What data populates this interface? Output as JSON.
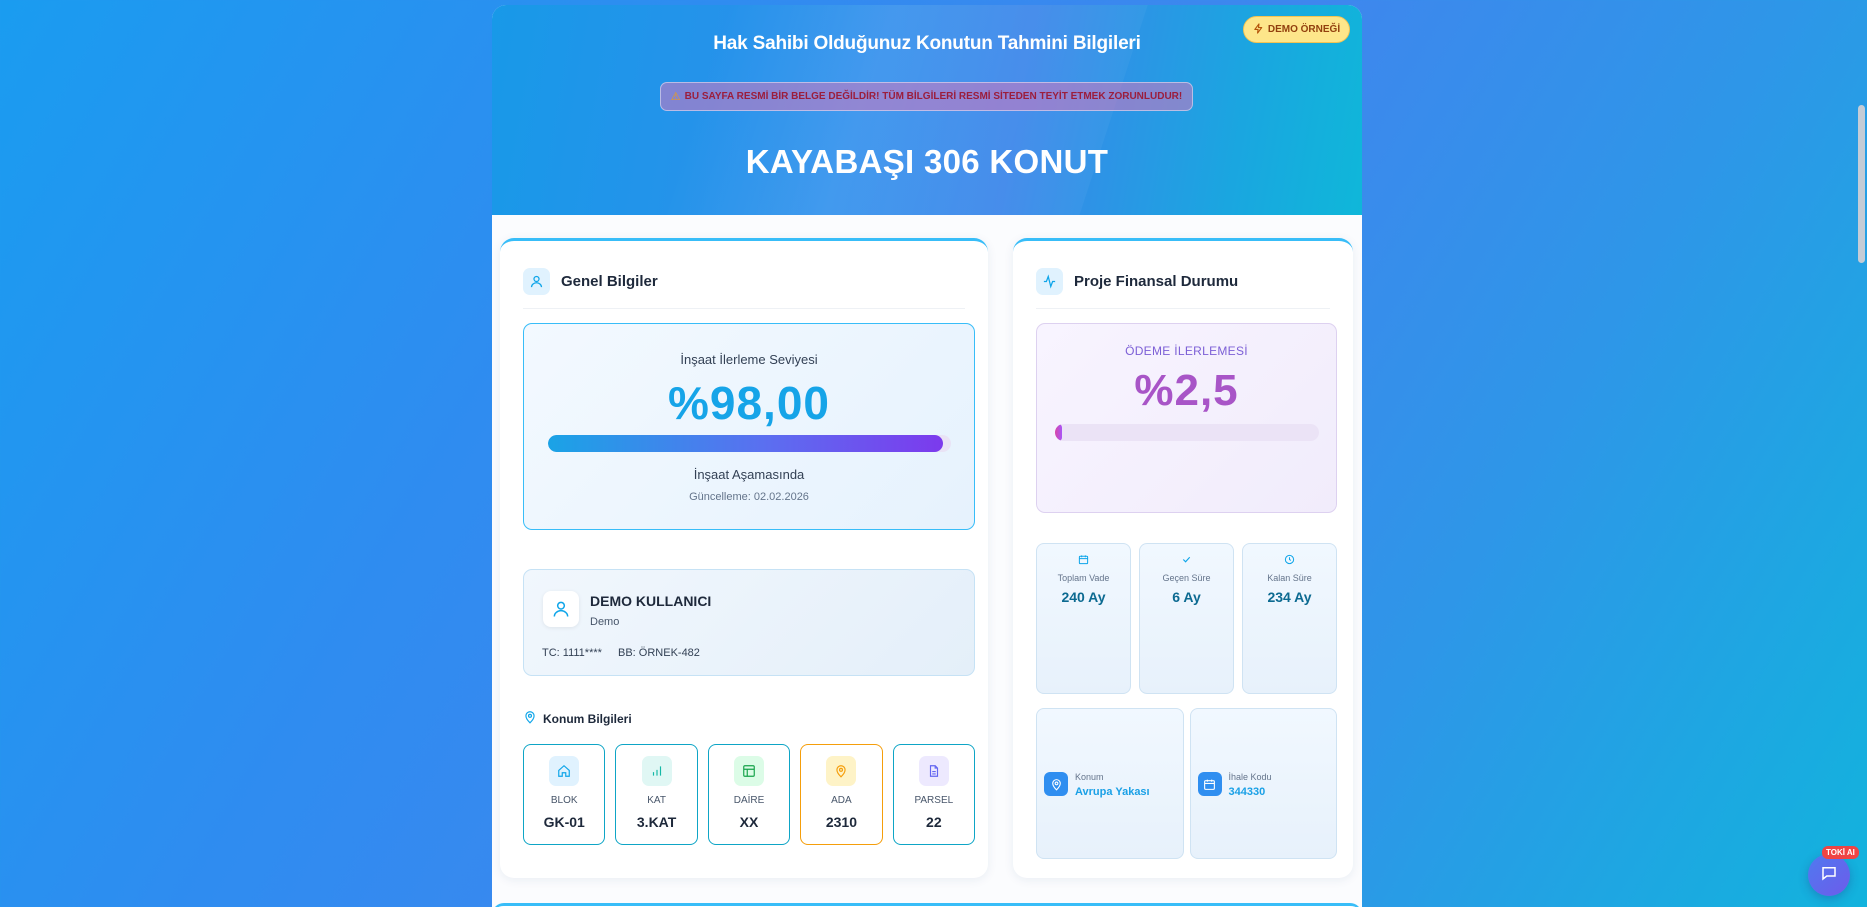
{
  "hero": {
    "title": "Hak Sahibi Olduğunuz Konutun Tahmini Bilgileri",
    "warning": "BU SAYFA RESMİ BİR BELGE DEĞİLDİR! TÜM BİLGİLERİ RESMİ SİTEDEN TEYİT ETMEK ZORUNLUDUR!",
    "project_name": "KAYABAŞI 306 KONUT",
    "demo_badge": "DEMO ÖRNEĞİ"
  },
  "general": {
    "title": "Genel Bilgiler",
    "progress": {
      "label": "İnşaat İlerleme Seviyesi",
      "value": "%98,00",
      "fraction": 0.98,
      "stage": "İnşaat Aşamasında",
      "update": "Güncelleme: 02.02.2026"
    },
    "user": {
      "name": "DEMO KULLANICI",
      "role": "Demo",
      "tc": "TC: 1111****",
      "bb": "BB: ÖRNEK-482"
    },
    "location": {
      "title": "Konum Bilgileri",
      "tiles": [
        {
          "label": "BLOK",
          "value": "GK-01",
          "icon": "home-icon",
          "color": "#e0f2fe"
        },
        {
          "label": "KAT",
          "value": "3.KAT",
          "icon": "bar-chart-icon",
          "color": "#e0f7f4"
        },
        {
          "label": "DAİRE",
          "value": "XX",
          "icon": "layout-icon",
          "color": "#dcfce7"
        },
        {
          "label": "ADA",
          "value": "2310",
          "icon": "map-pin-icon",
          "color": "#fef3c7"
        },
        {
          "label": "PARSEL",
          "value": "22",
          "icon": "document-icon",
          "color": "#ede9fe"
        }
      ]
    }
  },
  "finance": {
    "title": "Proje Finansal Durumu",
    "payment": {
      "label": "ÖDEME İLERLEMESİ",
      "value": "%2,5",
      "fraction": 0.025
    },
    "stats": [
      {
        "label": "Toplam Vade",
        "value": "240 Ay",
        "icon": "calendar-icon"
      },
      {
        "label": "Geçen Süre",
        "value": "6 Ay",
        "icon": "check-icon"
      },
      {
        "label": "Kalan Süre",
        "value": "234 Ay",
        "icon": "clock-icon"
      }
    ],
    "info": [
      {
        "label": "Konum",
        "value": "Avrupa Yakası",
        "icon": "map-pin-icon"
      },
      {
        "label": "İhale Kodu",
        "value": "344330",
        "icon": "calendar-icon"
      }
    ]
  },
  "chat": {
    "badge": "TOKİ AI",
    "icon": "chat-icon"
  }
}
